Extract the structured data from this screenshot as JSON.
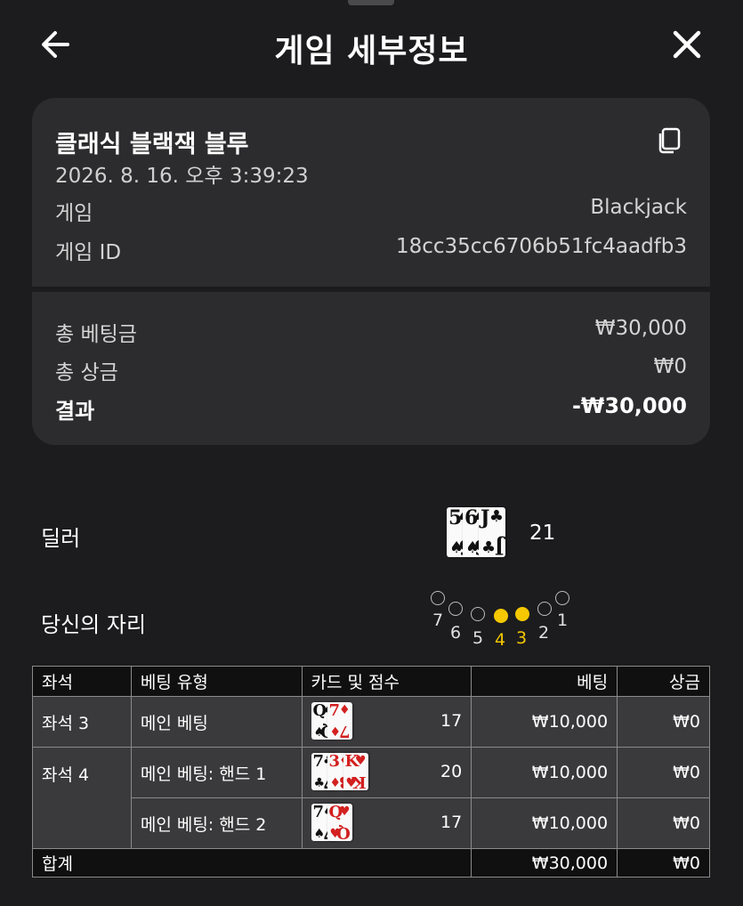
{
  "header": {
    "title": "게임 세부정보",
    "back_icon": "arrow-left-icon",
    "close_icon": "close-icon"
  },
  "summary": {
    "game_name": "클래식 블랙잭 블루",
    "datetime": "2026. 8. 16. 오후 3:39:23",
    "copy_icon": "copy-icon",
    "game_label": "게임",
    "game_value": "Blackjack",
    "game_id_label": "게임 ID",
    "game_id_value": "18cc35cc6706b51fc4aadfb3",
    "total_bet_label": "총 베팅금",
    "total_bet_value": "₩30,000",
    "total_win_label": "총 상금",
    "total_win_value": "₩0",
    "result_label": "결과",
    "result_value": "-₩30,000"
  },
  "dealer": {
    "label": "딜러",
    "cards": [
      {
        "rank": "5",
        "suit": "♠",
        "color": "black"
      },
      {
        "rank": "6",
        "suit": "♠",
        "color": "black"
      },
      {
        "rank": "J",
        "suit": "♣",
        "color": "black"
      }
    ],
    "score": "21"
  },
  "seats": {
    "label": "당신의 자리",
    "items": [
      {
        "num": "7",
        "active": false
      },
      {
        "num": "6",
        "active": false
      },
      {
        "num": "5",
        "active": false
      },
      {
        "num": "4",
        "active": true
      },
      {
        "num": "3",
        "active": true
      },
      {
        "num": "2",
        "active": false
      },
      {
        "num": "1",
        "active": false
      }
    ],
    "active_color": "#f5c800"
  },
  "table": {
    "headers": {
      "seat": "좌석",
      "bet_type": "베팅 유형",
      "cards_score": "카드 및 점수",
      "bet": "베팅",
      "win": "상금"
    },
    "rows": [
      {
        "seat": "좌석 3",
        "bet_type": "메인 베팅",
        "cards": [
          {
            "rank": "Q",
            "suit": "♠",
            "color": "black"
          },
          {
            "rank": "7",
            "suit": "♦",
            "color": "red"
          }
        ],
        "score": "17",
        "bet": "₩10,000",
        "win": "₩0"
      },
      {
        "seat": "좌석 4",
        "bet_type": "메인 베팅: 핸드 1",
        "cards": [
          {
            "rank": "7",
            "suit": "♣",
            "color": "black"
          },
          {
            "rank": "3",
            "suit": "♦",
            "color": "red"
          },
          {
            "rank": "K",
            "suit": "♥",
            "color": "red"
          }
        ],
        "score": "20",
        "bet": "₩10,000",
        "win": "₩0"
      },
      {
        "seat": "",
        "bet_type": "메인 베팅: 핸드 2",
        "cards": [
          {
            "rank": "7",
            "suit": "♠",
            "color": "black"
          },
          {
            "rank": "Q",
            "suit": "♥",
            "color": "red"
          }
        ],
        "score": "17",
        "bet": "₩10,000",
        "win": "₩0"
      }
    ],
    "footer": {
      "label": "합계",
      "bet": "₩30,000",
      "win": "₩0"
    }
  }
}
